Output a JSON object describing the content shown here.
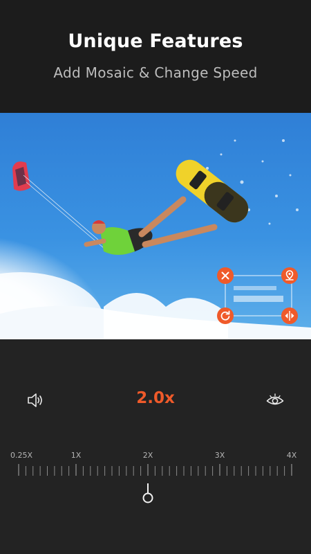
{
  "header": {
    "title": "Unique Features",
    "subtitle": "Add Mosaic & Change Speed"
  },
  "mosaic_box": {
    "icons": [
      "close-icon",
      "pin-icon",
      "rotate-icon",
      "flip-icon"
    ],
    "accent": "#ef5a2a"
  },
  "speed_control": {
    "current_speed": "2.0x",
    "value": 2.0,
    "scale_labels": [
      "0.25X",
      "1X",
      "2X",
      "3X",
      "4X"
    ],
    "accent": "#ef5a2a"
  },
  "toolbar": {
    "left_icon": "volume-icon",
    "right_icon": "eye-icon"
  }
}
